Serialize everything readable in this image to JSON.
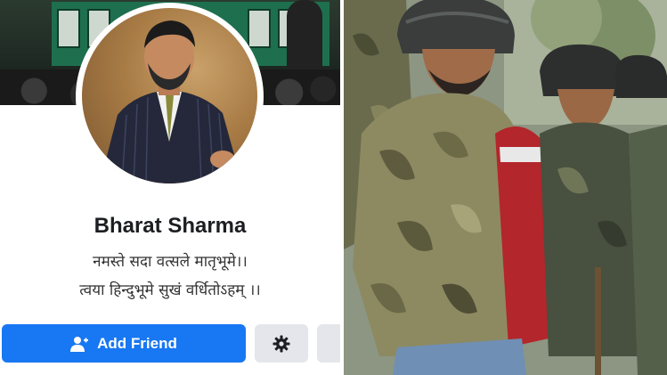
{
  "profile": {
    "name": "Bharat Sharma",
    "bio_line_1": "नमस्ते सदा वत्सले मातृभूमे।।",
    "bio_line_2": "त्वया हिन्दुभूमे सुखं वर्धितोऽहम् ।।"
  },
  "actions": {
    "add_friend_label": "Add Friend",
    "add_friend_icon": "add-person-icon",
    "settings_icon": "gear-icon",
    "more_icon": "more-icon"
  },
  "colors": {
    "primary_button": "#1877f2",
    "secondary_button": "#e4e6eb",
    "name_text": "#1c1e21"
  }
}
